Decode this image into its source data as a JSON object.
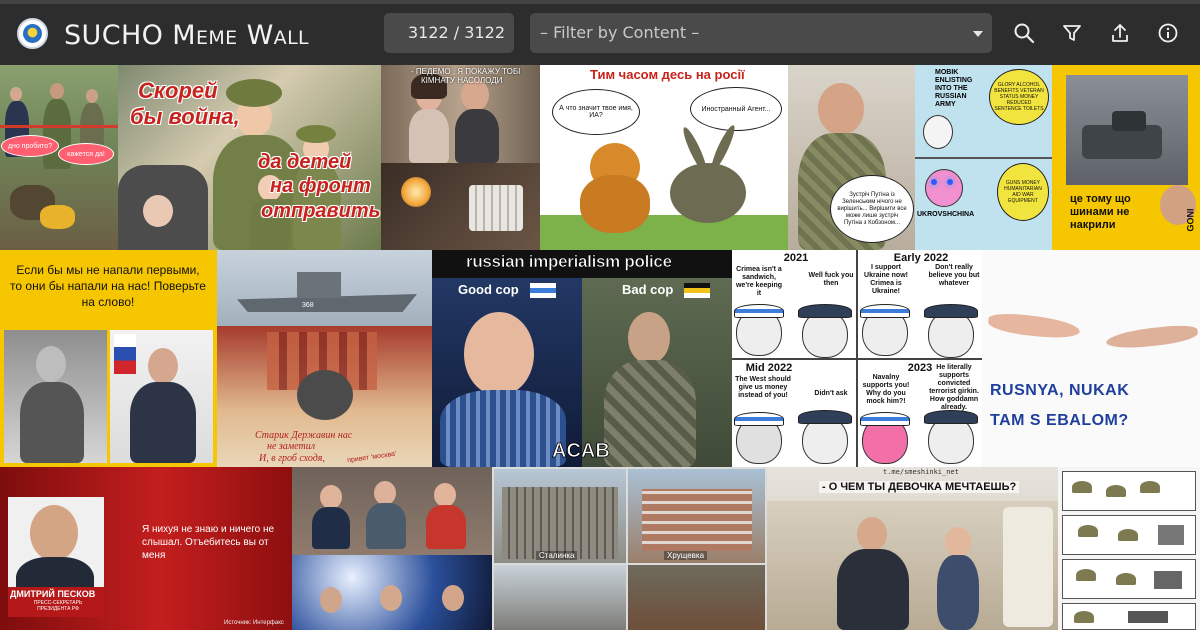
{
  "app": {
    "title": "SUCHO Meme Wall"
  },
  "toolbar": {
    "counter": "3122 / 3122",
    "filter_value": "– Filter by Content –",
    "buttons": [
      {
        "name": "search",
        "icon": "search-icon"
      },
      {
        "name": "filter",
        "icon": "funnel-icon"
      },
      {
        "name": "share",
        "icon": "upload-icon"
      },
      {
        "name": "info",
        "icon": "info-icon"
      }
    ]
  },
  "memes": {
    "m1": {
      "bubble1": "дно пробито?",
      "bubble2": "кажется да!"
    },
    "m2": {
      "line1": "Скорей",
      "line2": "бы война,",
      "line3": "да детей",
      "line4": "на фронт",
      "line5": "отправить"
    },
    "m3": {
      "line1": "- ПЕДЕМО , Я ПОКАЖУ ТОБІ",
      "line2": "КІМНАТУ НАСОЛОДИ"
    },
    "m4": {
      "title": "Тим часом десь на росії",
      "bubble_left": "А что значит твое имя, ИА?",
      "bubble_right": "Иностранный Агент..."
    },
    "m5": {
      "text": "Зустріч Путіна із Зеленським нічого не вирішить... Вирішити все може лише зустріч Путіна з Кобзоном..."
    },
    "m6": {
      "top_left": "MOBIK ENLISTING INTO THE RUSSIAN ARMY",
      "top_right": "GLORY ALCOHOL BENEFITS VETERAN STATUS MONEY REDUCED SENTENCE TOILETS",
      "bottom_left": "UKROVSHCHINA",
      "bottom_right": "GUNS MONEY HUMANITARIAN AID WAR EQUIPMENT"
    },
    "m7": {
      "caption": "це тому що шинами не накрили",
      "watermark": "GONI"
    },
    "m8": {
      "text": "Если бы мы не напали первыми, то они бы напали на нас! Поверьте на слово!"
    },
    "m9": {
      "hull": "368",
      "line1": "Старик Державин нас",
      "line2": "не заметил",
      "line3": "И, в гроб сходя,",
      "line4": "привет 'москва'"
    },
    "m10": {
      "title": "russian imperialism police",
      "good": "Good cop",
      "bad": "Bad cop",
      "bottom": "ACAB"
    },
    "m11": {
      "p1_year": "2021",
      "p1_left": "Crimea isn't a sandwich, we're keeping it",
      "p1_right": "Well fuck you then",
      "p2_year": "Early 2022",
      "p2_left": "I support Ukraine now! Crimea is Ukraine!",
      "p2_right": "Don't really believe you but whatever",
      "p3_year": "Mid 2022",
      "p3_left": "The West should give us money instead of you!",
      "p3_right": "Didn't ask",
      "p4_year": "2023",
      "p4_left": "Navalny supports you! Why do you mock him?!",
      "p4_right": "He literally supports convicted terrorist girkin. How goddamn already."
    },
    "m12": {
      "line1": "RUSNYA, NUKAK",
      "line2": "TAM S EBALOM?"
    },
    "m13": {
      "quote": "Я нихуя не знаю и ничего не слышал. Отъебитесь вы от меня",
      "name": "ДМИТРИЙ ПЕСКОВ",
      "role": "ПРЕСС-СЕКРЕТАРЬ ПРЕЗИДЕНТА РФ",
      "source": "Источник: Интерфакс"
    },
    "m15": {
      "stalinka": "Сталинка",
      "hrushevka": "Хрущевка"
    },
    "m16": {
      "tag": "t.me/smeshinki_net",
      "title": "- О ЧЕМ ТЫ ДЕВОЧКА МЕЧТАЕШЬ?"
    }
  },
  "colors": {
    "topbar": "#2d2d2d",
    "input_bg": "#4a4a4a",
    "yellow": "#f6c700"
  }
}
